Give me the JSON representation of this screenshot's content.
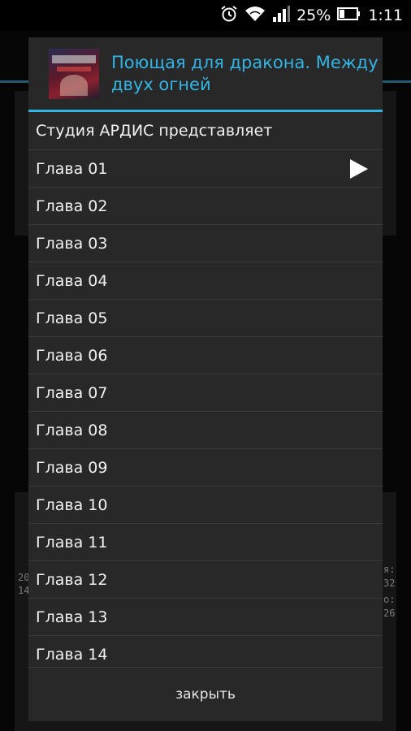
{
  "status_bar": {
    "battery_percent": "25%",
    "time": "1:11",
    "icons": [
      "alarm-icon",
      "wifi-icon",
      "signal-icon",
      "battery-icon"
    ]
  },
  "background": {
    "fragments": [
      "20",
      "14",
      "я:",
      "32",
      "о:",
      "26"
    ]
  },
  "dialog": {
    "title": "Поющая для дракона. Между двух огней",
    "cover_icon": "book-cover-image",
    "accent_color": "#33b5e5",
    "items": [
      {
        "label": "Студия АРДИС представляет"
      },
      {
        "label": "Глава 01",
        "playing": true
      },
      {
        "label": "Глава 02"
      },
      {
        "label": "Глава 03"
      },
      {
        "label": "Глава 04"
      },
      {
        "label": "Глава 05"
      },
      {
        "label": "Глава 06"
      },
      {
        "label": "Глава 07"
      },
      {
        "label": "Глава 08"
      },
      {
        "label": "Глава 09"
      },
      {
        "label": "Глава 10"
      },
      {
        "label": "Глава 11"
      },
      {
        "label": "Глава 12"
      },
      {
        "label": "Глава 13"
      },
      {
        "label": "Глава 14"
      }
    ],
    "close_label": "закрыть"
  }
}
